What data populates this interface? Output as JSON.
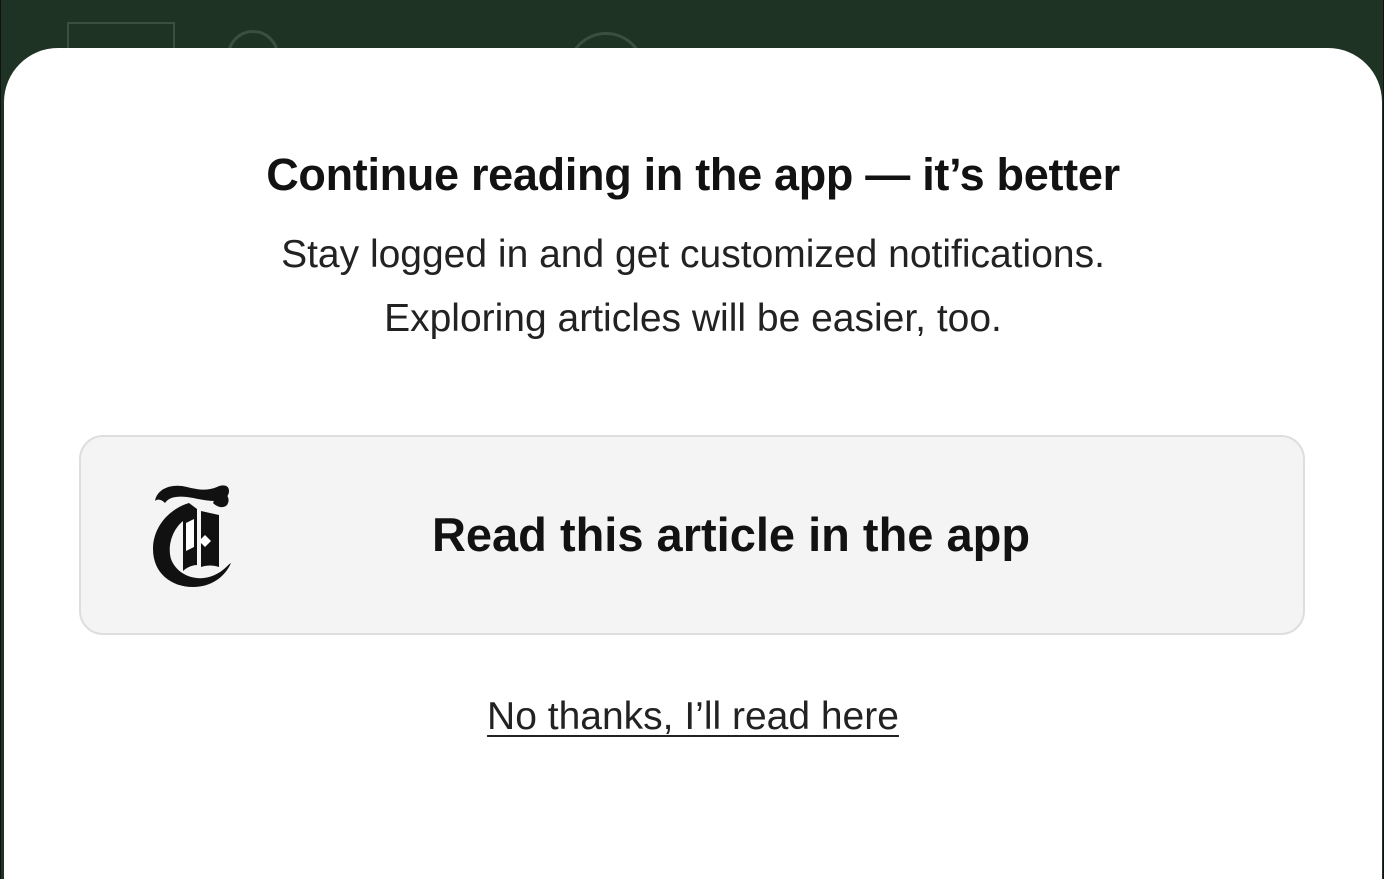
{
  "modal": {
    "title": "Continue reading in the app — it’s better",
    "subtitle_line1": "Stay logged in and get customized notifications.",
    "subtitle_line2": "Exploring articles will be easier, too.",
    "open_app_button": {
      "label": "Read this article in the app",
      "icon": "nyt-t-logo-icon"
    },
    "dismiss_link": "No thanks, I’ll read here"
  },
  "colors": {
    "page_behind": "#1e3323",
    "sheet": "#ffffff",
    "button_bg": "#f4f4f4",
    "text": "#121212"
  }
}
